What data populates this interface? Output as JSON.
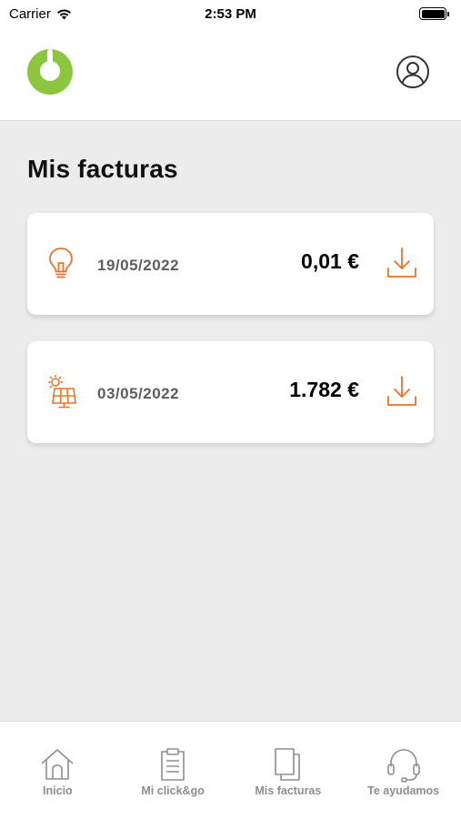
{
  "status_bar": {
    "carrier": "Carrier",
    "time": "2:53 PM",
    "icons": [
      "wifi-icon",
      "battery-icon"
    ]
  },
  "header": {
    "logo": "power-logo",
    "profile_icon": "user-icon"
  },
  "colors": {
    "brand_green": "#8cc63f",
    "accent_orange": "#e8732a",
    "tab_gray": "#8e8e8e",
    "background": "#ececec"
  },
  "page": {
    "title": "Mis facturas"
  },
  "invoices": [
    {
      "icon": "lightbulb-icon",
      "date": "19/05/2022",
      "amount": "0,01 €",
      "action_icon": "download-icon"
    },
    {
      "icon": "solar-panel-icon",
      "date": "03/05/2022",
      "amount": "1.782 €",
      "action_icon": "download-icon"
    }
  ],
  "tabs": [
    {
      "label": "Inicio",
      "icon": "home-icon"
    },
    {
      "label": "Mi click&go",
      "icon": "clipboard-icon"
    },
    {
      "label": "Mis facturas",
      "icon": "documents-icon"
    },
    {
      "label": "Te ayudamos",
      "icon": "headset-icon"
    }
  ]
}
